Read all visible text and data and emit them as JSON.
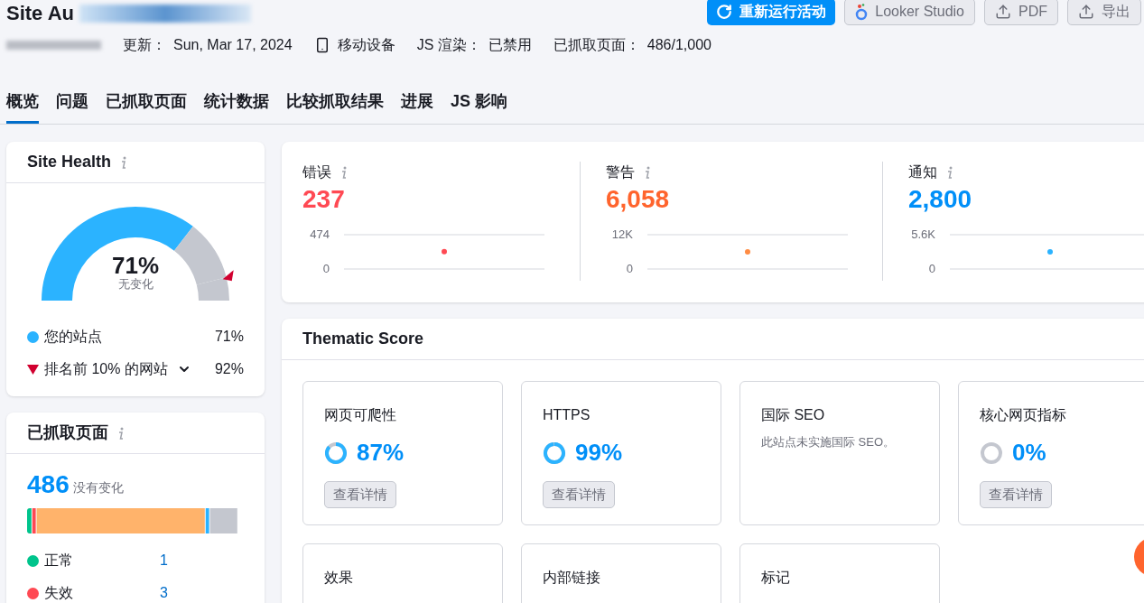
{
  "header": {
    "title": "Site Au",
    "buttons": [
      {
        "kind": "rerun",
        "label": "重新运行活动"
      },
      {
        "kind": "looker",
        "label": "Looker Studio"
      },
      {
        "kind": "upload",
        "label": "PDF"
      },
      {
        "kind": "upload",
        "label": "导出"
      }
    ]
  },
  "info": [
    {
      "label": "更新：",
      "value": "Sun, Mar 17, 2024"
    },
    {
      "kind": "device",
      "value": "移动设备"
    },
    {
      "label": "JS 渲染：",
      "value": "已禁用"
    },
    {
      "label": "已抓取页面：",
      "value": "486/1,000"
    }
  ],
  "tabs": [
    {
      "label": "概览",
      "selected": true
    },
    {
      "label": "问题",
      "selected": false
    },
    {
      "label": "已抓取页面",
      "selected": false
    },
    {
      "label": "统计数据",
      "selected": false
    },
    {
      "label": "比较抓取结果",
      "selected": false
    },
    {
      "label": "进展",
      "selected": false
    },
    {
      "label": "JS 影响",
      "selected": false
    }
  ],
  "site_health": {
    "title": "Site Health",
    "level": 0.71,
    "value": "71%",
    "change": "无变化",
    "legend": [
      {
        "kind": "dot",
        "color": "#2bb3ff",
        "label": "您的站点",
        "value": "71%"
      },
      {
        "kind": "triangle",
        "color": "#d1002f",
        "label": "排名前 10% 的网站",
        "value": "92%",
        "expanded": false
      }
    ]
  },
  "crawled": {
    "title": "已抓取页面",
    "count": "486",
    "change": "没有变化",
    "legend": [
      {
        "color": "#00c48c",
        "label": "正常",
        "value": "1"
      },
      {
        "color": "#ff4953",
        "label": "失效",
        "value": "3"
      }
    ]
  },
  "issues": [
    {
      "label": "错误",
      "value": "237",
      "color": "#ff4953",
      "chart_data": {
        "type": "scatter",
        "yticks": [
          {
            "value": 0,
            "label": "0"
          },
          {
            "value": 474,
            "label": "474"
          }
        ],
        "ylim": [
          0,
          474
        ],
        "series": [
          {
            "color": "#ff4953",
            "values": [
              240
            ]
          }
        ]
      }
    },
    {
      "label": "警告",
      "value": "6,058",
      "color": "#ff642d",
      "chart_data": {
        "type": "scatter",
        "yticks": [
          {
            "value": 0,
            "label": "0"
          },
          {
            "value": 12000,
            "label": "12K"
          }
        ],
        "ylim": [
          0,
          12000
        ],
        "series": [
          {
            "color": "#ff8c43",
            "values": [
              6000
            ]
          }
        ]
      }
    },
    {
      "label": "通知",
      "value": "2,800",
      "color": "#008ff8",
      "chart_data": {
        "type": "scatter",
        "yticks": [
          {
            "value": 0,
            "label": "0"
          },
          {
            "value": 5600,
            "label": "5.6K"
          }
        ],
        "ylim": [
          0,
          5600
        ],
        "series": [
          {
            "color": "#2bb3ff",
            "values": [
              2800
            ]
          }
        ]
      }
    }
  ],
  "thematic": {
    "title": "Thematic Score",
    "cards": [
      {
        "kind": "score",
        "title": "网页可爬性",
        "value": "87%",
        "button": "查看详情"
      },
      {
        "kind": "score",
        "title": "HTTPS",
        "value": "99%",
        "button": "查看详情"
      },
      {
        "kind": "message",
        "title": "国际 SEO",
        "message": "此站点未实施国际 SEO。"
      },
      {
        "kind": "score",
        "title": "核心网页指标",
        "value": "0%",
        "button": "查看详情"
      },
      {
        "kind": "partial",
        "title": "效果"
      },
      {
        "kind": "partial",
        "title": "内部链接"
      },
      {
        "kind": "partial",
        "title": "标记"
      }
    ]
  }
}
